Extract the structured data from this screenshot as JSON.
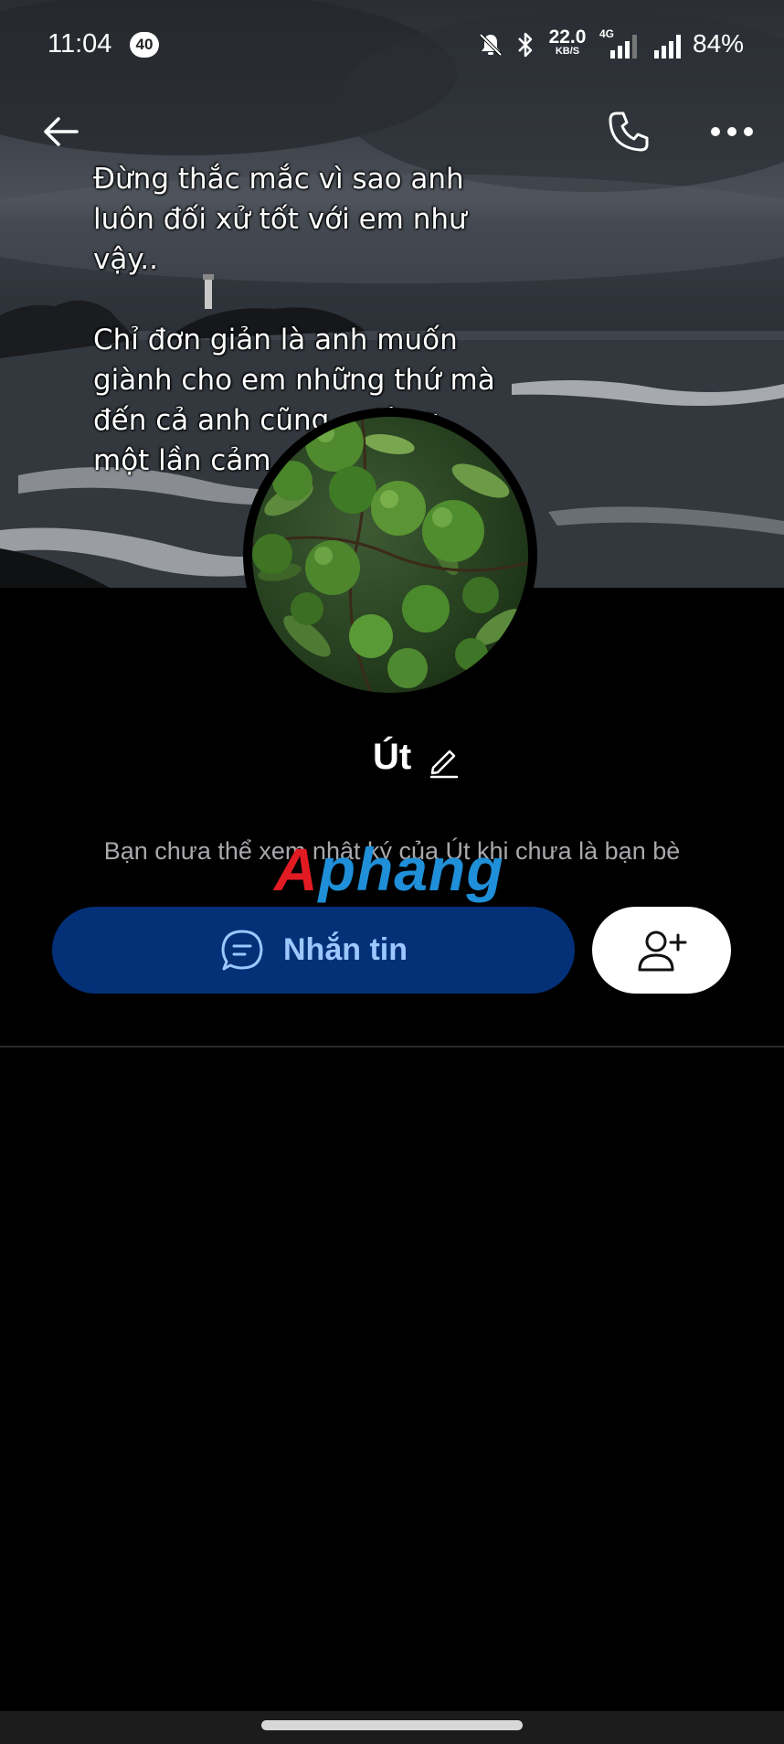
{
  "status_bar": {
    "time": "11:04",
    "notification_count": "40",
    "net_speed_value": "22.0",
    "net_speed_unit": "KB/S",
    "network_type": "4G",
    "battery": "84%"
  },
  "cover": {
    "lines_1": [
      "Đừng thắc mắc vì sao anh",
      "luôn đối xử tốt với em như",
      "vậy.."
    ],
    "lines_2": [
      "Chỉ đơn giản là anh muốn",
      "giành cho em những thứ mà",
      "đến cả anh cũng ... từng",
      "một lần cảm"
    ]
  },
  "profile": {
    "name": "Út",
    "notice": "Bạn chưa thể xem nhật ký của Út khi chưa là bạn bè"
  },
  "actions": {
    "message_label": "Nhắn tin"
  },
  "watermark": {
    "part1": "A",
    "part2": "phang"
  },
  "icons": {
    "back": "arrow-left-icon",
    "call": "phone-icon",
    "more": "more-horizontal-icon",
    "edit": "pencil-icon",
    "message": "chat-bubble-icon",
    "add_friend": "add-user-icon"
  },
  "colors": {
    "message_button_bg": "#043078",
    "message_button_text": "#9cc7ff",
    "watermark_red": "#e21b23",
    "watermark_blue": "#1e8fd8"
  }
}
